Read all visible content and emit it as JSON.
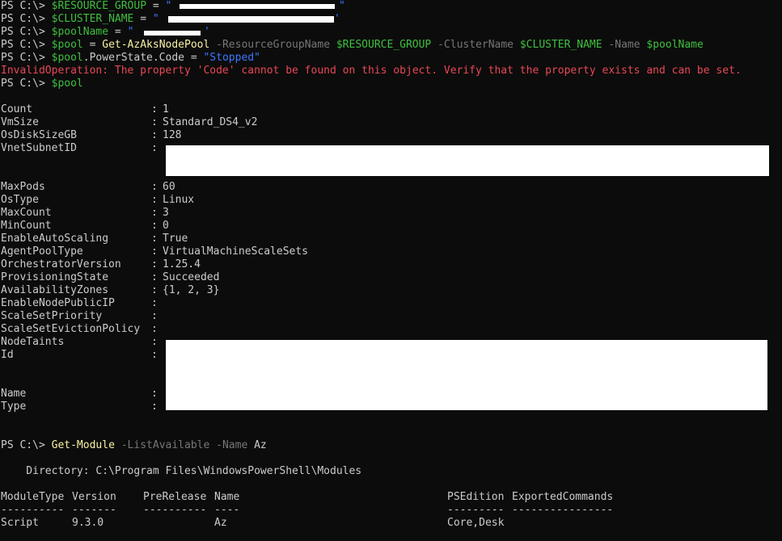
{
  "prompt": "PS C:\\> ",
  "cmd1": {
    "var": "$RESOURCE_GROUP",
    "eq": " = ",
    "q1": "\"",
    "q2": "\""
  },
  "cmd2": {
    "var": "$CLUSTER_NAME",
    "eq": " = ",
    "q1": "\"",
    "q2": "'"
  },
  "cmd3": {
    "var": "$poolName",
    "eq": " = ",
    "q1": "\"",
    "q2": "'"
  },
  "cmd4": {
    "var": "$pool",
    "eq": " = ",
    "cmdlet": "Get-AzAksNodePool",
    "p1": " -ResourceGroupName ",
    "v1": "$RESOURCE_GROUP",
    "p2": " -ClusterName ",
    "v2": "$CLUSTER_NAME",
    "p3": " -Name ",
    "v3": "$poolName"
  },
  "cmd5": {
    "var": "$pool",
    "member": ".PowerState.Code",
    "eq": " = ",
    "str": "\"Stopped\""
  },
  "error": "InvalidOperation: The property 'Code' cannot be found on this object. Verify that the property exists and can be set.",
  "cmd6": {
    "var": "$pool"
  },
  "props": [
    {
      "name": "Count",
      "value": "1"
    },
    {
      "name": "VmSize",
      "value": "Standard_DS4_v2"
    },
    {
      "name": "OsDiskSizeGB",
      "value": "128"
    },
    {
      "name": "VnetSubnetID",
      "value": ""
    },
    {
      "name": "MaxPods",
      "value": "60"
    },
    {
      "name": "OsType",
      "value": "Linux"
    },
    {
      "name": "MaxCount",
      "value": "3"
    },
    {
      "name": "MinCount",
      "value": "0"
    },
    {
      "name": "EnableAutoScaling",
      "value": "True"
    },
    {
      "name": "AgentPoolType",
      "value": "VirtualMachineScaleSets"
    },
    {
      "name": "OrchestratorVersion",
      "value": "1.25.4"
    },
    {
      "name": "ProvisioningState",
      "value": "Succeeded"
    },
    {
      "name": "AvailabilityZones",
      "value": "{1, 2, 3}"
    },
    {
      "name": "EnableNodePublicIP",
      "value": ""
    },
    {
      "name": "ScaleSetPriority",
      "value": ""
    },
    {
      "name": "ScaleSetEvictionPolicy",
      "value": ""
    },
    {
      "name": "NodeTaints",
      "value": ""
    },
    {
      "name": "Id",
      "value": ""
    },
    {
      "name": "Name",
      "value": ""
    },
    {
      "name": "Type",
      "value": ""
    }
  ],
  "colon": ":",
  "cmd7": {
    "cmdlet": "Get-Module",
    "p1": " -ListAvailable",
    "p2": " -Name ",
    "v": "Az"
  },
  "directory": "    Directory: C:\\Program Files\\WindowsPowerShell\\Modules",
  "table": {
    "headers": [
      "ModuleType",
      "Version",
      "PreRelease",
      "Name",
      "PSEdition",
      "ExportedCommands"
    ],
    "dashes": [
      "----------",
      "-------",
      "----------",
      "----",
      "---------",
      "----------------"
    ],
    "rows": [
      [
        "Script",
        "9.3.0",
        "",
        "Az",
        "Core,Desk",
        ""
      ]
    ]
  }
}
